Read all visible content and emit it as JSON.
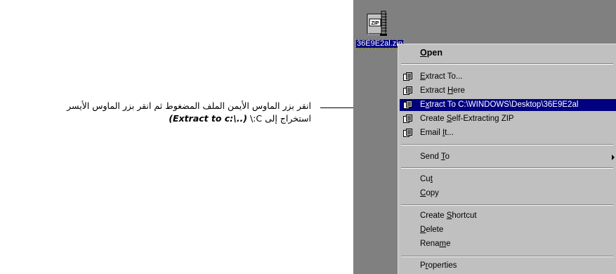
{
  "annotation": {
    "line1": "انقر بزر الماوس الأيمن الملف المضغوط ثم انقر بزر الماوس الأيسر",
    "line2": "استخراج إلى C:\\ (Extract to c:\\..)"
  },
  "desktop": {
    "icon_name": "zip-archive-icon",
    "icon_badge": "ZIP",
    "file_label": "36E9E2al.zip"
  },
  "menu": {
    "open": {
      "pre": "",
      "u": "O",
      "post": "pen"
    },
    "extract_to": {
      "pre": "",
      "u": "E",
      "post": "xtract To..."
    },
    "extract_here": {
      "pre": "Extract ",
      "u": "H",
      "post": "ere"
    },
    "extract_to_path": {
      "pre": "E",
      "u": "x",
      "post": "tract To C:\\WINDOWS\\Desktop\\36E9E2al"
    },
    "create_sfx": {
      "pre": "Create ",
      "u": "S",
      "post": "elf-Extracting ZIP"
    },
    "email_it": {
      "pre": "Email ",
      "u": "I",
      "post": "t..."
    },
    "send_to": {
      "pre": "Send ",
      "u": "T",
      "post": "o"
    },
    "cut": {
      "pre": "Cu",
      "u": "t",
      "post": ""
    },
    "copy": {
      "pre": "",
      "u": "C",
      "post": "opy"
    },
    "create_shortcut": {
      "pre": "Create ",
      "u": "S",
      "post": "hortcut"
    },
    "delete": {
      "pre": "",
      "u": "D",
      "post": "elete"
    },
    "rename": {
      "pre": "Rena",
      "u": "m",
      "post": "e"
    },
    "properties": {
      "pre": "P",
      "u": "r",
      "post": "operties"
    },
    "item_icon": "winzip-icon",
    "highlight_color": "#000080",
    "menu_bg": "#c0c0c0",
    "desktop_bg": "#808080"
  }
}
